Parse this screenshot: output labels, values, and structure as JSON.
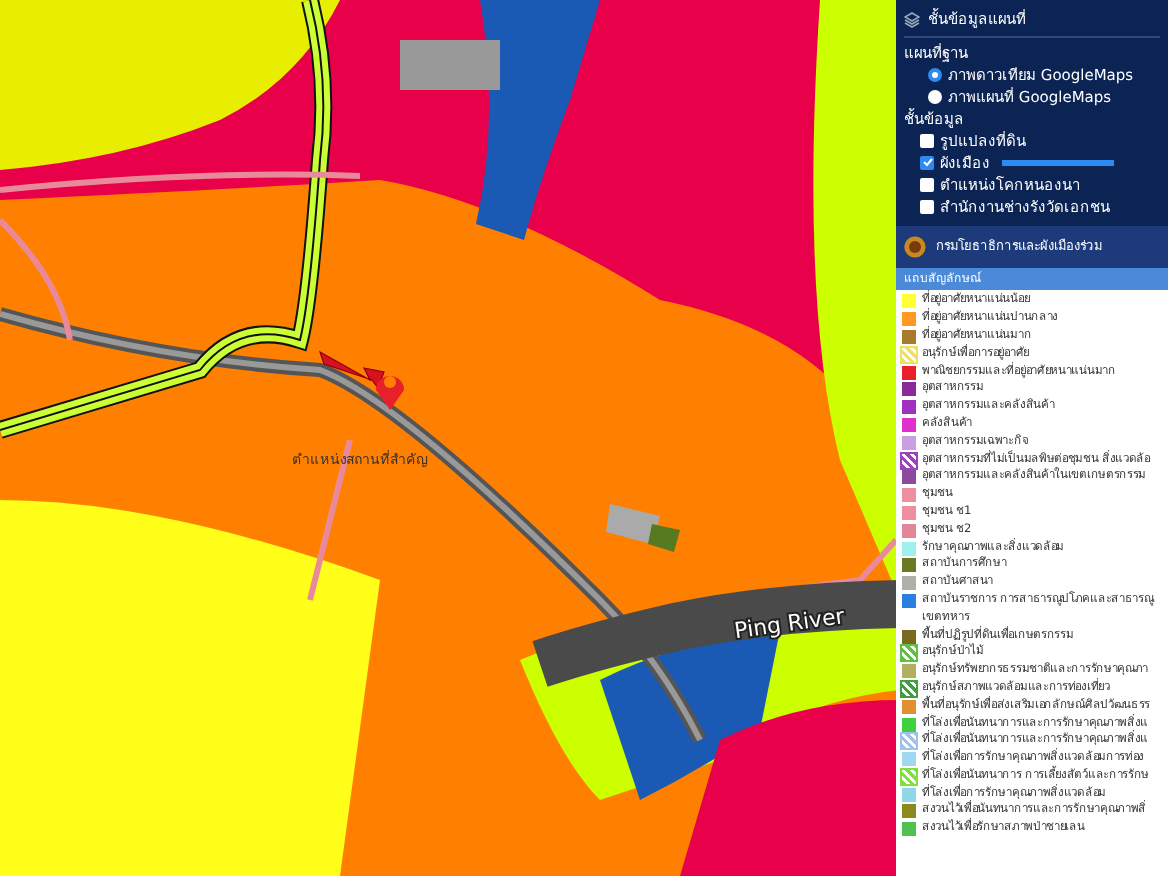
{
  "map": {
    "labels": [
      {
        "kind": "river",
        "text": "Ping River"
      },
      {
        "kind": "place",
        "text": "ตำแหน่งสถานที่สำคัญ"
      }
    ]
  },
  "layer_panel": {
    "title": "ชั้นข้อมูลแผนที่",
    "basemap_heading": "แผนที่ฐาน",
    "basemaps": [
      {
        "label": "ภาพดาวเทียม GoogleMaps",
        "selected": true
      },
      {
        "label": "ภาพแผนที่ GoogleMaps",
        "selected": false
      }
    ],
    "layers_heading": "ชั้นข้อมูล",
    "layers": [
      {
        "label": "รูปแปลงที่ดิน",
        "checked": false
      },
      {
        "label": "ผังเมือง",
        "checked": true,
        "level": 1
      },
      {
        "label": "ตำแหน่งโคกหนองนา",
        "checked": false
      },
      {
        "label": "สำนักงานช่างรังวัดเอกชน",
        "checked": false
      }
    ],
    "banner": "กรมโยธาธิการและผังเมืองร่วม"
  },
  "legend": {
    "title": "แถบสัญลักษณ์",
    "items": [
      {
        "label": "ที่อยู่อาศัยหนาแน่นน้อย",
        "color": "#ffff33",
        "kind": "solid"
      },
      {
        "label": "ที่อยู่อาศัยหนาแน่นปานกลาง",
        "color": "#ff9922",
        "kind": "solid"
      },
      {
        "label": "ที่อยู่อาศัยหนาแน่นมาก",
        "color": "#a87b2c",
        "kind": "solid"
      },
      {
        "label": "อนุรักษ์เพื่อการอยู่อาศัย",
        "color": "#f0e060",
        "kind": "hatched"
      },
      {
        "label": "พาณิชยกรรมและที่อยู่อาศัยหนาแน่นมาก",
        "color": "#e8202a",
        "kind": "solid"
      },
      {
        "label": "อุตสาหกรรม",
        "color": "#8a2a9a",
        "kind": "solid"
      },
      {
        "label": "อุตสาหกรรมและคลังสินค้า",
        "color": "#a030c0",
        "kind": "solid"
      },
      {
        "label": "คลังสินค้า",
        "color": "#e030d0",
        "kind": "solid"
      },
      {
        "label": "อุตสาหกรรมเฉพาะกิจ",
        "color": "#c8a0e0",
        "kind": "solid"
      },
      {
        "label": "อุตสาหกรรมที่ไม่เป็นมลพิษต่อชุมชน สิ่งแวดล้อ",
        "color": "#a040c0",
        "kind": "hatched"
      },
      {
        "label": "อุตสาหกรรมและคลังสินค้าในเขตเกษตรกรรม",
        "color": "#8a4aa0",
        "kind": "solid"
      },
      {
        "label": "ชุมชน",
        "color": "#ee8fa0",
        "kind": "solid"
      },
      {
        "label": "ชุมชน ช1",
        "color": "#ee8fa0",
        "kind": "solid"
      },
      {
        "label": "ชุมชน ช2",
        "color": "#e08898",
        "kind": "solid"
      },
      {
        "label": "รักษาคุณภาพและสิ่งแวดล้อม",
        "color": "#a0f0f0",
        "kind": "solid"
      },
      {
        "label": "สถาบันการศึกษา",
        "color": "#6a7a20",
        "kind": "solid"
      },
      {
        "label": "สถาบันศาสนา",
        "color": "#b0b0a8",
        "kind": "solid"
      },
      {
        "label": "สถาบันราชการ การสาธารณูปโภคและสาธารณู",
        "note": "เขตทหาร",
        "color": "#2a80e0",
        "kind": "solid"
      },
      {
        "label": "พื้นที่ปฏิรูปที่ดินเพื่อเกษตรกรรม",
        "color": "#7a6a20",
        "kind": "solid"
      },
      {
        "label": "อนุรักษ์ป่าไม้",
        "color": "#60c040",
        "kind": "hatched"
      },
      {
        "label": "อนุรักษ์ทรัพยากรธรรมชาติและการรักษาคุณภา",
        "color": "#b0b060",
        "kind": "solid"
      },
      {
        "label": "อนุรักษ์สภาพแวดล้อมและการท่องเที่ยว",
        "color": "#40a040",
        "kind": "hatched"
      },
      {
        "label": "พื้นที่อนุรักษ์เพื่อส่งเสริมเอกลักษณ์ศิลปวัฒนธรร",
        "color": "#e09030",
        "kind": "solid"
      },
      {
        "label": "ที่โล่งเพื่อนันทนาการและการรักษาคุณภาพสิ่งแ",
        "color": "#40d040",
        "kind": "solid"
      },
      {
        "label": "ที่โล่งเพื่อนันทนาการและการรักษาคุณภาพสิ่งแ",
        "color": "#a0c0f0",
        "kind": "hatched"
      },
      {
        "label": "ที่โล่งเพื่อการรักษาคุณภาพสิ่งแวดล้อมการท่อง",
        "color": "#a0d8f0",
        "kind": "solid"
      },
      {
        "label": "ที่โล่งเพื่อนันทนาการ การเลี้ยงสัตว์และการรักษ",
        "color": "#80e040",
        "kind": "hatched"
      },
      {
        "label": "ที่โล่งเพื่อการรักษาคุณภาพสิ่งแวดล้อม",
        "color": "#90d8e8",
        "kind": "solid"
      },
      {
        "label": "สงวนไว้เพื่อนันทนาการและการรักษาคุณภาพสิ่",
        "color": "#8a8a20",
        "kind": "solid"
      },
      {
        "label": "สงวนไว้เพื่อรักษาสภาพป่าชายเลน",
        "color": "#50c050",
        "kind": "solid"
      }
    ]
  }
}
